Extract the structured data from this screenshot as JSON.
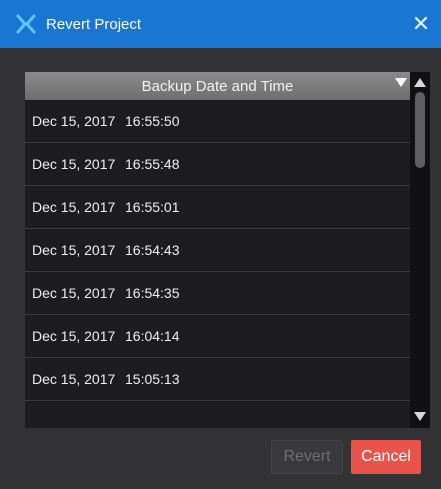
{
  "window": {
    "title": "Revert Project",
    "close_glyph": "✕",
    "title_icon": "x-logo-icon",
    "accent_color": "#1976d2"
  },
  "table": {
    "column_header": "Backup Date and Time",
    "sort_icon": "sort-descending-icon",
    "rows": [
      {
        "date": "Dec 15, 2017",
        "time": "16:55:50"
      },
      {
        "date": "Dec 15, 2017",
        "time": "16:55:48"
      },
      {
        "date": "Dec 15, 2017",
        "time": "16:55:01"
      },
      {
        "date": "Dec 15, 2017",
        "time": "16:54:43"
      },
      {
        "date": "Dec 15, 2017",
        "time": "16:54:35"
      },
      {
        "date": "Dec 15, 2017",
        "time": "16:04:14"
      },
      {
        "date": "Dec 15, 2017",
        "time": "15:05:13"
      },
      {
        "date": "",
        "time": ""
      }
    ]
  },
  "buttons": {
    "revert_label": "Revert",
    "cancel_label": "Cancel",
    "cancel_color": "#e8534b"
  }
}
